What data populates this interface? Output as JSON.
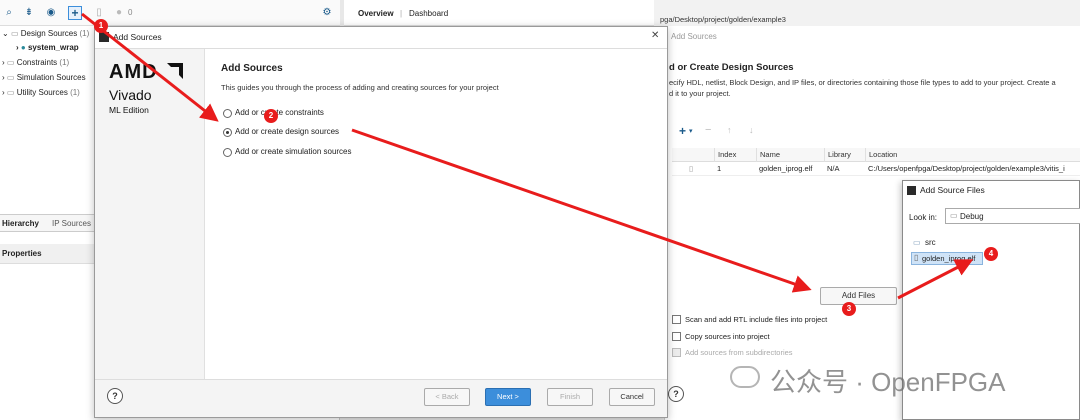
{
  "project_panel": {
    "toolbar_count": "0",
    "tree": [
      {
        "label": "Design Sources",
        "count": "(1)"
      },
      {
        "label": "system_wrap",
        "count": ""
      },
      {
        "label": "Constraints",
        "count": "(1)"
      },
      {
        "label": "Simulation Sources",
        "count": ""
      },
      {
        "label": "Utility Sources",
        "count": "(1)"
      }
    ],
    "tabs": [
      "Hierarchy",
      "IP Sources"
    ],
    "properties_title": "Properties"
  },
  "top_tabs": {
    "overview": "Overview",
    "separator": "|",
    "dashboard": "Dashboard"
  },
  "path_text": "pga/Desktop/project/golden/example3",
  "background_wizard": {
    "title": "Add Sources",
    "heading": "d or Create Design Sources",
    "description": "ecify HDL, netlist, Block Design, and IP files, or directories containing those file types to add to your project. Create a",
    "description2": "d it to your project.",
    "columns": [
      "Index",
      "Name",
      "Library",
      "Location"
    ],
    "row": {
      "index": "1",
      "name": "golden_iprog.elf",
      "library": "N/A",
      "location": "C:/Users/openfpga/Desktop/project/golden/example3/vitis_i"
    },
    "add_files_label": "Add Files",
    "options": [
      {
        "label": "Scan and add RTL include files into project",
        "enabled": true
      },
      {
        "label": "Copy sources into project",
        "enabled": true
      },
      {
        "label": "Add sources from subdirectories",
        "enabled": false
      }
    ],
    "help": "?"
  },
  "dialog": {
    "title": "Add Sources",
    "close": "✕",
    "brand": {
      "amd": "AMD",
      "product": "Vivado",
      "edition": "ML Edition"
    },
    "heading": "Add Sources",
    "description": "This guides you through the process of adding and creating sources for your project",
    "options": [
      {
        "label": "Add or create constraints",
        "selected": false
      },
      {
        "label": "Add or create design sources",
        "selected": true
      },
      {
        "label": "Add or create simulation sources",
        "selected": false
      }
    ],
    "buttons": {
      "back": "< Back",
      "next": "Next >",
      "finish": "Finish",
      "cancel": "Cancel"
    },
    "help": "?"
  },
  "add_source_files": {
    "title": "Add Source Files",
    "look_in_label": "Look in:",
    "look_in_value": "Debug",
    "items": [
      {
        "name": "src",
        "type": "folder",
        "selected": false
      },
      {
        "name": "golden_iprog.elf",
        "type": "file",
        "selected": true
      }
    ]
  },
  "markers": [
    "1",
    "2",
    "3",
    "4"
  ],
  "watermark": "公众号 · OpenFPGA",
  "colors": {
    "accent": "#3c8edb",
    "annotation": "#e81c1c",
    "selection": "#cfe3f7"
  }
}
